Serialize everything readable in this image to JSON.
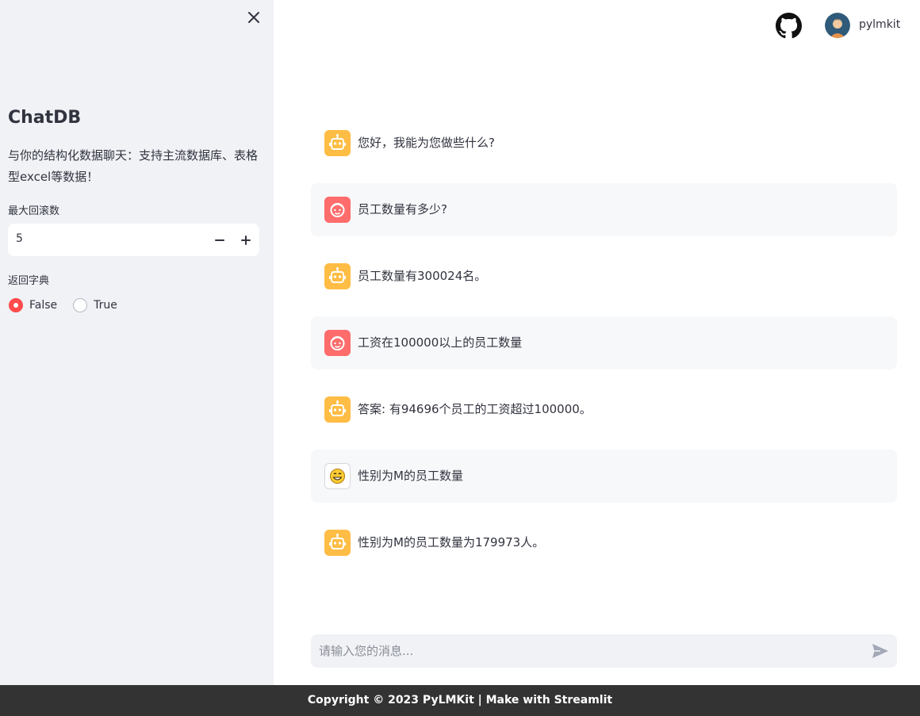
{
  "sidebar": {
    "title": "ChatDB",
    "description": "与你的结构化数据聊天：支持主流数据库、表格型excel等数据！",
    "max_rollback": {
      "label": "最大回滚数",
      "value": "5",
      "decrement_icon": "minus-icon",
      "increment_icon": "plus-icon"
    },
    "return_dict": {
      "label": "返回字典",
      "options": [
        {
          "label": "False",
          "selected": true
        },
        {
          "label": "True",
          "selected": false
        }
      ]
    },
    "close_icon": "close-icon"
  },
  "header": {
    "github_icon": "github-icon",
    "username": "pylmkit"
  },
  "chat": {
    "messages": [
      {
        "role": "assistant",
        "avatar": "robot-icon",
        "text": "您好，我能为您做些什么?"
      },
      {
        "role": "user",
        "avatar": "user-face-icon",
        "text": "员工数量有多少?"
      },
      {
        "role": "assistant",
        "avatar": "robot-icon",
        "text": "员工数量有300024名。"
      },
      {
        "role": "user",
        "avatar": "user-face-icon",
        "text": "工资在100000以上的员工数量"
      },
      {
        "role": "assistant",
        "avatar": "robot-icon",
        "text": "答案: 有94696个员工的工资超过100000。"
      },
      {
        "role": "user",
        "avatar": "grinning-emoji-icon",
        "text": "性别为M的员工数量"
      },
      {
        "role": "assistant",
        "avatar": "robot-icon",
        "text": "性别为M的员工数量为179973人。"
      }
    ],
    "input_placeholder": "请输入您的消息...",
    "send_icon": "send-icon"
  },
  "footer": {
    "text": "Copyright © 2023 PyLMKit | Make with Streamlit"
  },
  "colors": {
    "sidebar_bg": "#f0f2f6",
    "accent": "#ff4b4b",
    "assistant_avatar": "#ffbd45",
    "user_avatar": "#ff6c6c",
    "footer_bg": "#333333"
  }
}
